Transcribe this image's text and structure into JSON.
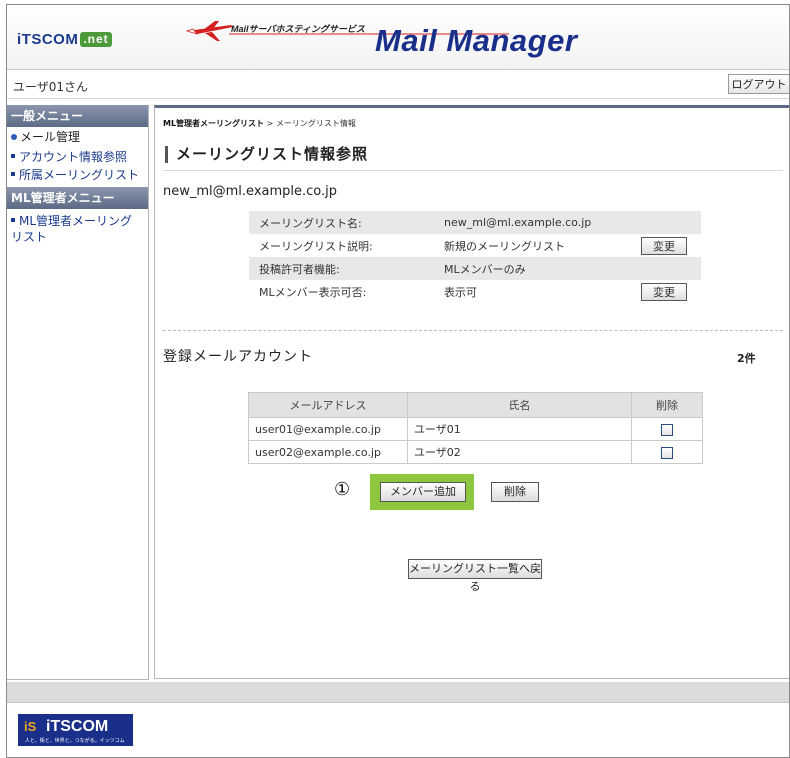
{
  "header": {
    "brand": "iTSCOM",
    "brand_suffix": ".net",
    "tagline": "Mailサーバホスティングサービス",
    "product": "Mail Manager"
  },
  "userbar": {
    "username": "ユーザ01さん",
    "logout_label": "ログアウト"
  },
  "sidebar": {
    "general_header": "一般メニュー",
    "mail_management": "メール管理",
    "items": [
      {
        "label": "アカウント情報参照"
      },
      {
        "label": "所属メーリングリスト"
      }
    ],
    "admin_header": "ML管理者メニュー",
    "admin_items": [
      {
        "label": "ML管理者メーリングリスト"
      }
    ]
  },
  "main": {
    "breadcrumb_parent": "ML管理者メーリングリスト",
    "breadcrumb_sep": ">",
    "breadcrumb_current": "メーリングリスト情報",
    "title": "メーリングリスト情報参照",
    "ml_address": "new_ml@ml.example.co.jp",
    "info_rows": [
      {
        "label": "メーリングリスト名:",
        "value": "new_ml@ml.example.co.jp"
      },
      {
        "label": "メーリングリスト説明:",
        "value": "新規のメーリングリスト",
        "button": "変更"
      },
      {
        "label": "投稿許可者機能:",
        "value": "MLメンバーのみ"
      },
      {
        "label": "MLメンバー表示可否:",
        "value": "表示可",
        "button": "変更"
      }
    ],
    "accounts_title": "登録メールアカウント",
    "accounts_count": "2件",
    "columns": [
      "メールアドレス",
      "氏名",
      "削除"
    ],
    "accounts": [
      {
        "email": "user01@example.co.jp",
        "name": "ユーザ01"
      },
      {
        "email": "user02@example.co.jp",
        "name": "ユーザ02"
      }
    ],
    "step_marker": "①",
    "add_member_label": "メンバー追加",
    "delete_label": "削除",
    "back_label": "メーリングリスト一覧へ戻る"
  },
  "footer": {
    "brand": "iTSCOM",
    "brand_mark": "iS",
    "slogan": "人と、街と、世界と。つながる。イッツコム"
  },
  "colors": {
    "brand_blue": "#1a2f8a",
    "highlight_green": "#8dc63f",
    "sidebar_header": "#5c6a85"
  }
}
